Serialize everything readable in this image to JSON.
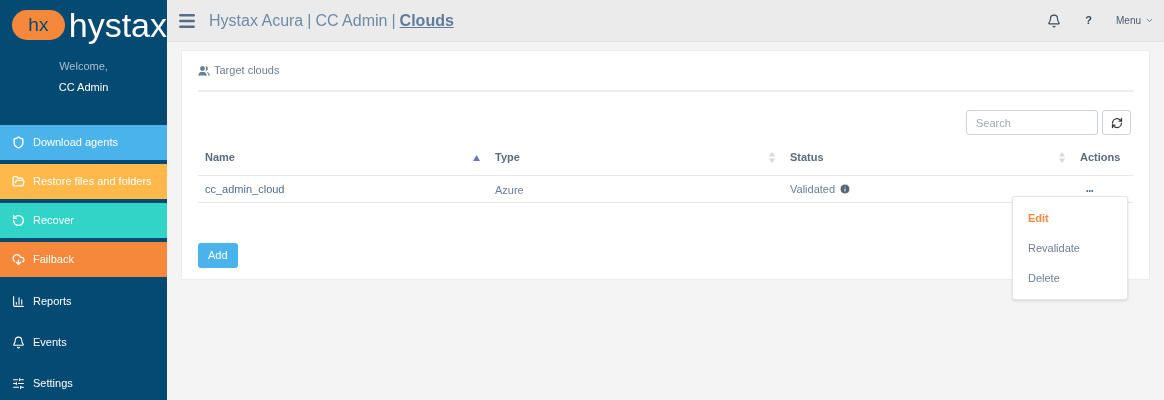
{
  "sidebar": {
    "logo": {
      "mark": "hx",
      "wordmark": "hystax"
    },
    "welcome": "Welcome,",
    "user": "CC Admin",
    "items": [
      {
        "label": "Download agents",
        "kind": "tile",
        "color": "#4bb3ec"
      },
      {
        "label": "Restore files and folders",
        "kind": "tile",
        "color": "#ffb84a"
      },
      {
        "label": "Recover",
        "kind": "tile",
        "color": "#33d4c8"
      },
      {
        "label": "Failback",
        "kind": "tile",
        "color": "#f5883a"
      },
      {
        "label": "Reports",
        "kind": "link"
      },
      {
        "label": "Events",
        "kind": "link"
      },
      {
        "label": "Settings",
        "kind": "link"
      }
    ]
  },
  "header": {
    "breadcrumb": [
      "Hystax Acura",
      "CC Admin"
    ],
    "separator": "|",
    "current": "Clouds",
    "help": "?",
    "menu": "Menu"
  },
  "panel": {
    "title": "Target clouds",
    "search": {
      "placeholder": "Search"
    },
    "table": {
      "columns": [
        {
          "label": "Name",
          "sorted": true
        },
        {
          "label": "Type",
          "sorted": false
        },
        {
          "label": "Status",
          "sorted": false
        },
        {
          "label": "Actions"
        }
      ],
      "rows": [
        {
          "name": "cc_admin_cloud",
          "type": "Azure",
          "status": "Validated",
          "actions": "•••"
        }
      ]
    },
    "add_button": "Add"
  },
  "dropdown": {
    "items": [
      {
        "label": "Edit",
        "selected": true
      },
      {
        "label": "Revalidate",
        "selected": false
      },
      {
        "label": "Delete",
        "selected": false
      }
    ]
  }
}
